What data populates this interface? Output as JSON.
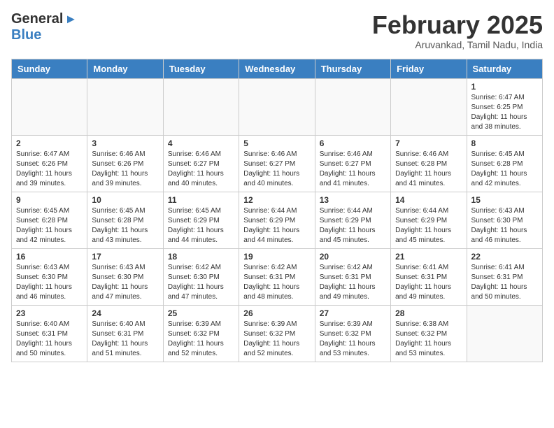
{
  "header": {
    "logo_general": "General",
    "logo_blue": "Blue",
    "month_title": "February 2025",
    "location": "Aruvankad, Tamil Nadu, India"
  },
  "calendar": {
    "days_of_week": [
      "Sunday",
      "Monday",
      "Tuesday",
      "Wednesday",
      "Thursday",
      "Friday",
      "Saturday"
    ],
    "weeks": [
      [
        {
          "day": "",
          "info": ""
        },
        {
          "day": "",
          "info": ""
        },
        {
          "day": "",
          "info": ""
        },
        {
          "day": "",
          "info": ""
        },
        {
          "day": "",
          "info": ""
        },
        {
          "day": "",
          "info": ""
        },
        {
          "day": "1",
          "info": "Sunrise: 6:47 AM\nSunset: 6:25 PM\nDaylight: 11 hours\nand 38 minutes."
        }
      ],
      [
        {
          "day": "2",
          "info": "Sunrise: 6:47 AM\nSunset: 6:26 PM\nDaylight: 11 hours\nand 39 minutes."
        },
        {
          "day": "3",
          "info": "Sunrise: 6:46 AM\nSunset: 6:26 PM\nDaylight: 11 hours\nand 39 minutes."
        },
        {
          "day": "4",
          "info": "Sunrise: 6:46 AM\nSunset: 6:27 PM\nDaylight: 11 hours\nand 40 minutes."
        },
        {
          "day": "5",
          "info": "Sunrise: 6:46 AM\nSunset: 6:27 PM\nDaylight: 11 hours\nand 40 minutes."
        },
        {
          "day": "6",
          "info": "Sunrise: 6:46 AM\nSunset: 6:27 PM\nDaylight: 11 hours\nand 41 minutes."
        },
        {
          "day": "7",
          "info": "Sunrise: 6:46 AM\nSunset: 6:28 PM\nDaylight: 11 hours\nand 41 minutes."
        },
        {
          "day": "8",
          "info": "Sunrise: 6:45 AM\nSunset: 6:28 PM\nDaylight: 11 hours\nand 42 minutes."
        }
      ],
      [
        {
          "day": "9",
          "info": "Sunrise: 6:45 AM\nSunset: 6:28 PM\nDaylight: 11 hours\nand 42 minutes."
        },
        {
          "day": "10",
          "info": "Sunrise: 6:45 AM\nSunset: 6:28 PM\nDaylight: 11 hours\nand 43 minutes."
        },
        {
          "day": "11",
          "info": "Sunrise: 6:45 AM\nSunset: 6:29 PM\nDaylight: 11 hours\nand 44 minutes."
        },
        {
          "day": "12",
          "info": "Sunrise: 6:44 AM\nSunset: 6:29 PM\nDaylight: 11 hours\nand 44 minutes."
        },
        {
          "day": "13",
          "info": "Sunrise: 6:44 AM\nSunset: 6:29 PM\nDaylight: 11 hours\nand 45 minutes."
        },
        {
          "day": "14",
          "info": "Sunrise: 6:44 AM\nSunset: 6:29 PM\nDaylight: 11 hours\nand 45 minutes."
        },
        {
          "day": "15",
          "info": "Sunrise: 6:43 AM\nSunset: 6:30 PM\nDaylight: 11 hours\nand 46 minutes."
        }
      ],
      [
        {
          "day": "16",
          "info": "Sunrise: 6:43 AM\nSunset: 6:30 PM\nDaylight: 11 hours\nand 46 minutes."
        },
        {
          "day": "17",
          "info": "Sunrise: 6:43 AM\nSunset: 6:30 PM\nDaylight: 11 hours\nand 47 minutes."
        },
        {
          "day": "18",
          "info": "Sunrise: 6:42 AM\nSunset: 6:30 PM\nDaylight: 11 hours\nand 47 minutes."
        },
        {
          "day": "19",
          "info": "Sunrise: 6:42 AM\nSunset: 6:31 PM\nDaylight: 11 hours\nand 48 minutes."
        },
        {
          "day": "20",
          "info": "Sunrise: 6:42 AM\nSunset: 6:31 PM\nDaylight: 11 hours\nand 49 minutes."
        },
        {
          "day": "21",
          "info": "Sunrise: 6:41 AM\nSunset: 6:31 PM\nDaylight: 11 hours\nand 49 minutes."
        },
        {
          "day": "22",
          "info": "Sunrise: 6:41 AM\nSunset: 6:31 PM\nDaylight: 11 hours\nand 50 minutes."
        }
      ],
      [
        {
          "day": "23",
          "info": "Sunrise: 6:40 AM\nSunset: 6:31 PM\nDaylight: 11 hours\nand 50 minutes."
        },
        {
          "day": "24",
          "info": "Sunrise: 6:40 AM\nSunset: 6:31 PM\nDaylight: 11 hours\nand 51 minutes."
        },
        {
          "day": "25",
          "info": "Sunrise: 6:39 AM\nSunset: 6:32 PM\nDaylight: 11 hours\nand 52 minutes."
        },
        {
          "day": "26",
          "info": "Sunrise: 6:39 AM\nSunset: 6:32 PM\nDaylight: 11 hours\nand 52 minutes."
        },
        {
          "day": "27",
          "info": "Sunrise: 6:39 AM\nSunset: 6:32 PM\nDaylight: 11 hours\nand 53 minutes."
        },
        {
          "day": "28",
          "info": "Sunrise: 6:38 AM\nSunset: 6:32 PM\nDaylight: 11 hours\nand 53 minutes."
        },
        {
          "day": "",
          "info": ""
        }
      ]
    ]
  }
}
